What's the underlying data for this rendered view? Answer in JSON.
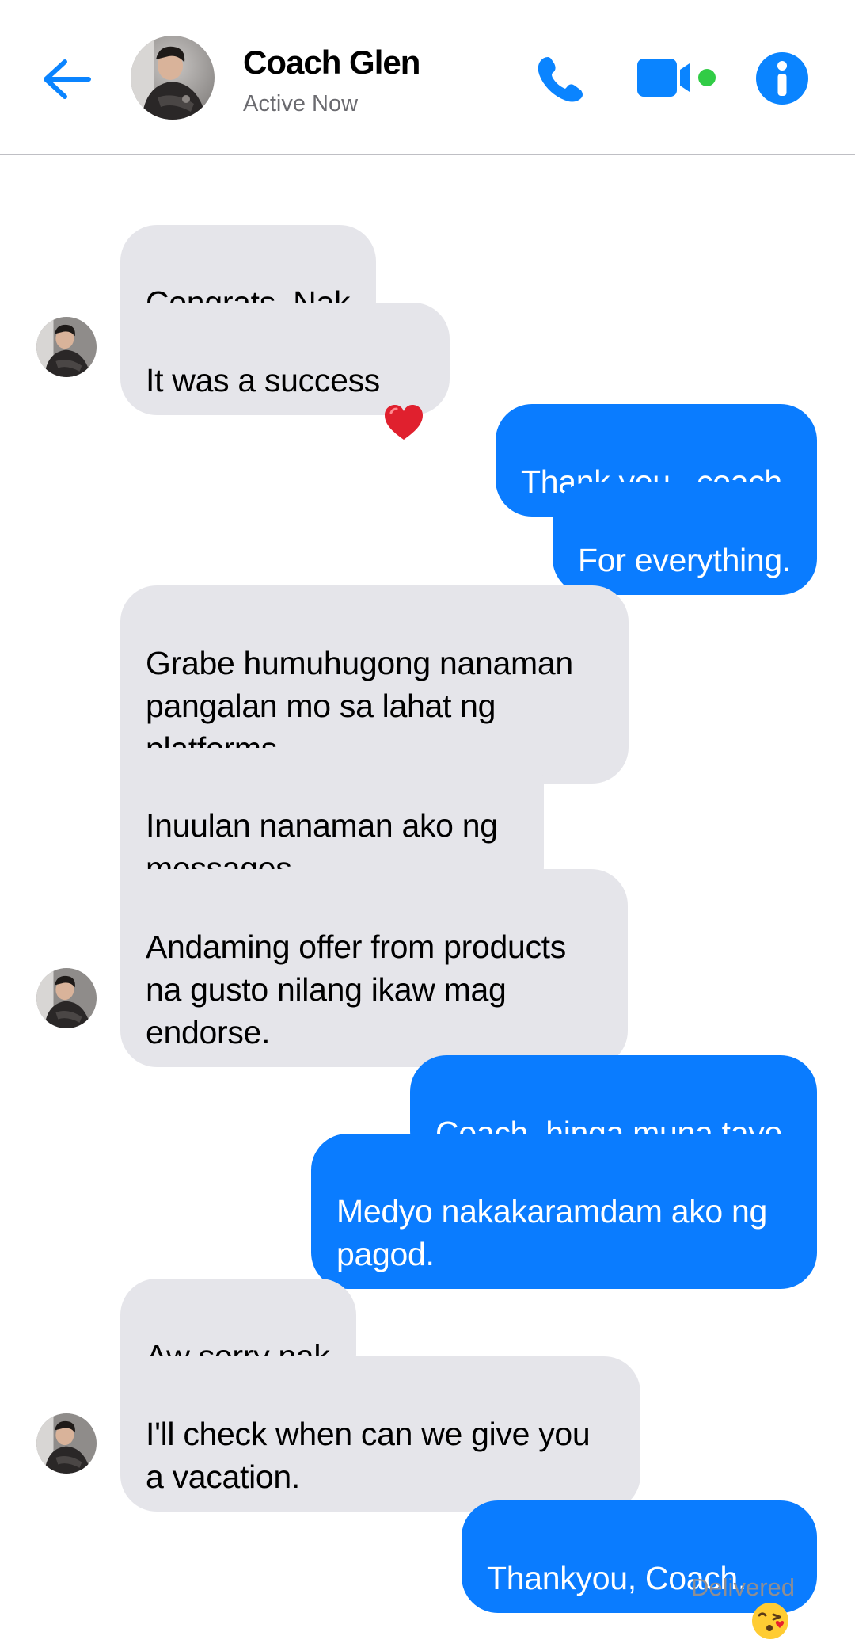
{
  "header": {
    "contact_name": "Coach Glen",
    "status": "Active Now",
    "back_icon": "arrow-left-icon",
    "call_icon": "phone-icon",
    "video_icon": "video-camera-icon",
    "info_icon": "info-icon",
    "accent_color": "#0a84ff",
    "online_color": "#31cc46"
  },
  "messages": [
    {
      "sender": "coach",
      "text": "Congrats, Nak"
    },
    {
      "sender": "coach",
      "text": "It was a success",
      "emoji": "red-heart-icon"
    },
    {
      "sender": "me",
      "text": "Thank you , coach."
    },
    {
      "sender": "me",
      "text": "For everything."
    },
    {
      "sender": "coach",
      "text": "Grabe humuhugong nanaman\npangalan mo sa lahat ng\nplatforms."
    },
    {
      "sender": "coach",
      "text": "Inuulan nanaman ako ng\nmessages"
    },
    {
      "sender": "coach",
      "text": "Andaming offer from products\nna gusto nilang ikaw mag\nendorse."
    },
    {
      "sender": "me",
      "text": "Coach, hinga muna tayo."
    },
    {
      "sender": "me",
      "text": "Medyo nakakaramdam ako ng\npagod."
    },
    {
      "sender": "coach",
      "text": "Aw sorry nak"
    },
    {
      "sender": "coach",
      "text": "I'll check when can we give you\na vacation."
    },
    {
      "sender": "me",
      "text": "Thankyou, Coach.",
      "emoji": "face-blowing-kiss-icon"
    }
  ],
  "receipt": "Delivered",
  "colors": {
    "incoming_bubble": "#e5e5ea",
    "outgoing_bubble": "#0a7cff"
  }
}
